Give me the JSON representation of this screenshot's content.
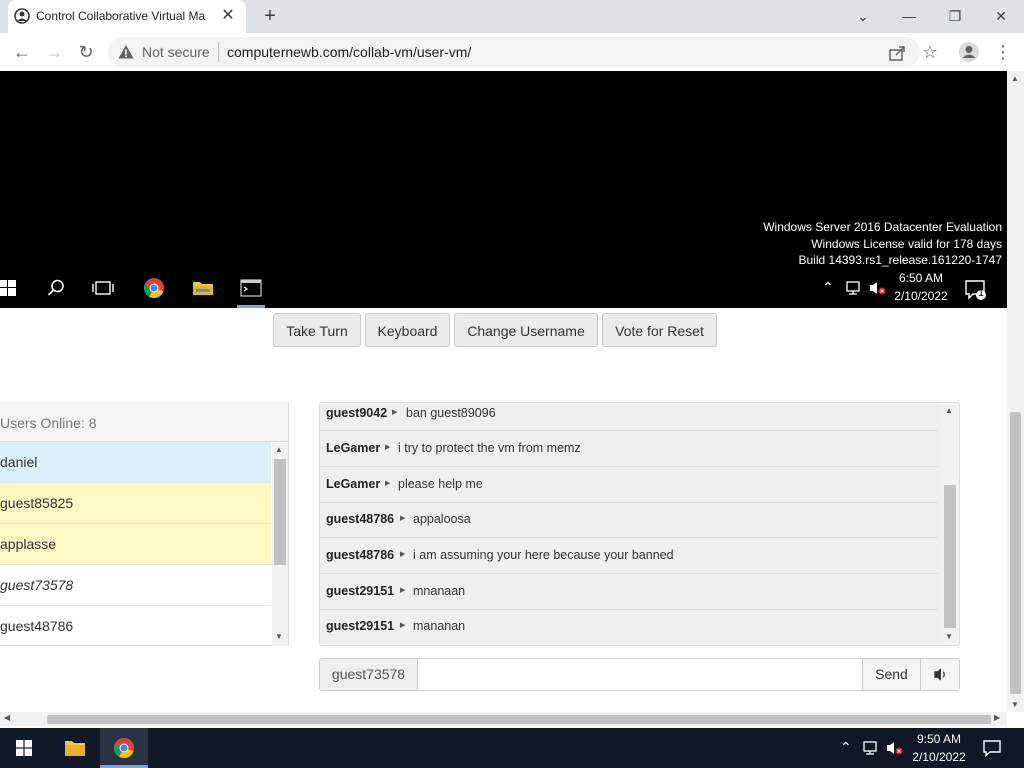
{
  "browser": {
    "tab_title": "Control Collaborative Virtual Ma",
    "security_label": "Not secure",
    "url": "computernewb.com/collab-vm/user-vm/"
  },
  "vm_screen": {
    "watermark_line1": "Windows Server 2016 Datacenter Evaluation",
    "watermark_line2": "Windows License valid for 178 days",
    "watermark_line3": "Build 14393.rs1_release.161220-1747",
    "clock_time": "6:50 AM",
    "clock_date": "2/10/2022",
    "notification_count": "1"
  },
  "controls": {
    "take_turn": "Take Turn",
    "keyboard": "Keyboard",
    "change_username": "Change Username",
    "vote_reset": "Vote for Reset"
  },
  "users": {
    "title": "Users Online: 8",
    "list": [
      {
        "name": "daniel"
      },
      {
        "name": "guest85825"
      },
      {
        "name": "applasse"
      },
      {
        "name": "guest73578"
      },
      {
        "name": "guest48786"
      }
    ]
  },
  "chat": {
    "messages": [
      {
        "user": "guest9042",
        "text": "ban guest89096"
      },
      {
        "user": "LeGamer",
        "text": "i try to protect the vm from memz"
      },
      {
        "user": "LeGamer",
        "text": "please help me"
      },
      {
        "user": "guest48786",
        "text": "appaloosa"
      },
      {
        "user": "guest48786",
        "text": "i am assuming your here because your banned"
      },
      {
        "user": "guest29151",
        "text": "mnanaan"
      },
      {
        "user": "guest29151",
        "text": "mananan"
      }
    ],
    "username": "guest73578",
    "input_value": "",
    "send_label": "Send"
  },
  "host_taskbar": {
    "clock_time": "9:50 AM",
    "clock_date": "2/10/2022"
  },
  "colors": {
    "admin_highlight": "#d9f0f8",
    "guest_highlight": "#fcf8c4",
    "host_taskbar": "#101827"
  }
}
